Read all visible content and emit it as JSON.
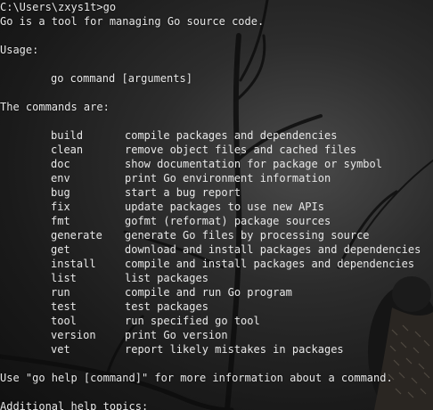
{
  "window": {
    "prompt": "C:\\Users\\zxys1t>go"
  },
  "intro": "Go is a tool for managing Go source code.",
  "usage_heading": "Usage:",
  "usage_line": "go command [arguments]",
  "commands_heading": "The commands are:",
  "commands": [
    {
      "name": "build",
      "desc": "compile packages and dependencies"
    },
    {
      "name": "clean",
      "desc": "remove object files and cached files"
    },
    {
      "name": "doc",
      "desc": "show documentation for package or symbol"
    },
    {
      "name": "env",
      "desc": "print Go environment information"
    },
    {
      "name": "bug",
      "desc": "start a bug report"
    },
    {
      "name": "fix",
      "desc": "update packages to use new APIs"
    },
    {
      "name": "fmt",
      "desc": "gofmt (reformat) package sources"
    },
    {
      "name": "generate",
      "desc": "generate Go files by processing source"
    },
    {
      "name": "get",
      "desc": "download and install packages and dependencies"
    },
    {
      "name": "install",
      "desc": "compile and install packages and dependencies"
    },
    {
      "name": "list",
      "desc": "list packages"
    },
    {
      "name": "run",
      "desc": "compile and run Go program"
    },
    {
      "name": "test",
      "desc": "test packages"
    },
    {
      "name": "tool",
      "desc": "run specified go tool"
    },
    {
      "name": "version",
      "desc": "print Go version"
    },
    {
      "name": "vet",
      "desc": "report likely mistakes in packages"
    }
  ],
  "help_hint": "Use \"go help [command]\" for more information about a command.",
  "additional_heading": "Additional help topics:",
  "colors": {
    "text": "#e8e8e8",
    "background": "#0c0c0c"
  }
}
